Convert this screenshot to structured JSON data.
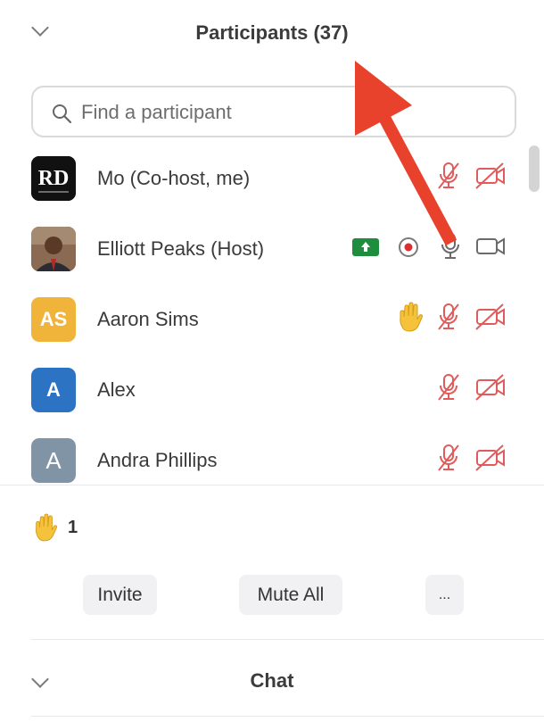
{
  "header": {
    "title": "Participants (37)"
  },
  "search": {
    "placeholder": "Find a participant"
  },
  "participants": [
    {
      "name": "Mo (Co-host, me)",
      "avatar": "logo",
      "avatar_text": "RD",
      "mic": "muted",
      "video": "off"
    },
    {
      "name": "Elliott Peaks (Host)",
      "avatar": "photo",
      "share": true,
      "recording": true,
      "mic": "on",
      "video": "on"
    },
    {
      "name": "Aaron Sims",
      "avatar": "initials",
      "initials": "AS",
      "avatar_color": "#f0b43a",
      "hand": true,
      "mic": "muted",
      "video": "off"
    },
    {
      "name": "Alex",
      "avatar": "initials",
      "initials": "A",
      "avatar_color": "#2d73c4",
      "mic": "muted",
      "video": "off"
    },
    {
      "name": "Andra Phillips",
      "avatar": "initials",
      "initials": "A",
      "avatar_color": "#8194a6",
      "mic": "muted",
      "video": "off"
    }
  ],
  "raised_hands": {
    "count": "1"
  },
  "actions": {
    "invite": "Invite",
    "mute_all": "Mute All",
    "more": "..."
  },
  "chat": {
    "title": "Chat"
  },
  "colors": {
    "muted_red": "#e05b5b",
    "share_green": "#1e8e3e",
    "annotation_arrow": "#e8412c"
  }
}
